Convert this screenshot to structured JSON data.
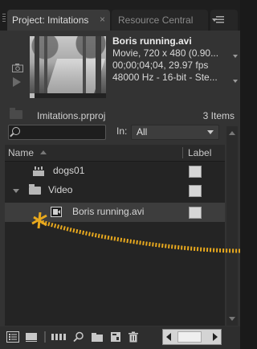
{
  "tabs": {
    "active": "Project: Imitations",
    "close_glyph": "×",
    "inactive": "Resource Central"
  },
  "preview": {
    "clip_title": "Boris running.avi",
    "info_lines": [
      "Movie, 720 x 480 (0.90...",
      "00;00;04;04, 29.97 fps",
      "48000 Hz - 16-bit - Ste..."
    ],
    "scrub_fraction": 0
  },
  "project": {
    "file": "Imitations.prproj",
    "items_count": "3 Items"
  },
  "search": {
    "placeholder": "",
    "in_label": "In:",
    "in_value": "All"
  },
  "list": {
    "col_name": "Name",
    "col_label": "Label",
    "rows": [
      {
        "name": "dogs01",
        "icon": "sequence-icon"
      },
      {
        "name": "Video",
        "icon": "folder-icon",
        "expanded": true
      },
      {
        "name": "Boris running.avi",
        "icon": "video-clip-icon",
        "selected": true
      }
    ]
  },
  "colors": {
    "panel_bg": "#333333",
    "list_bg": "#242424",
    "annotation": "#e7a81e"
  }
}
